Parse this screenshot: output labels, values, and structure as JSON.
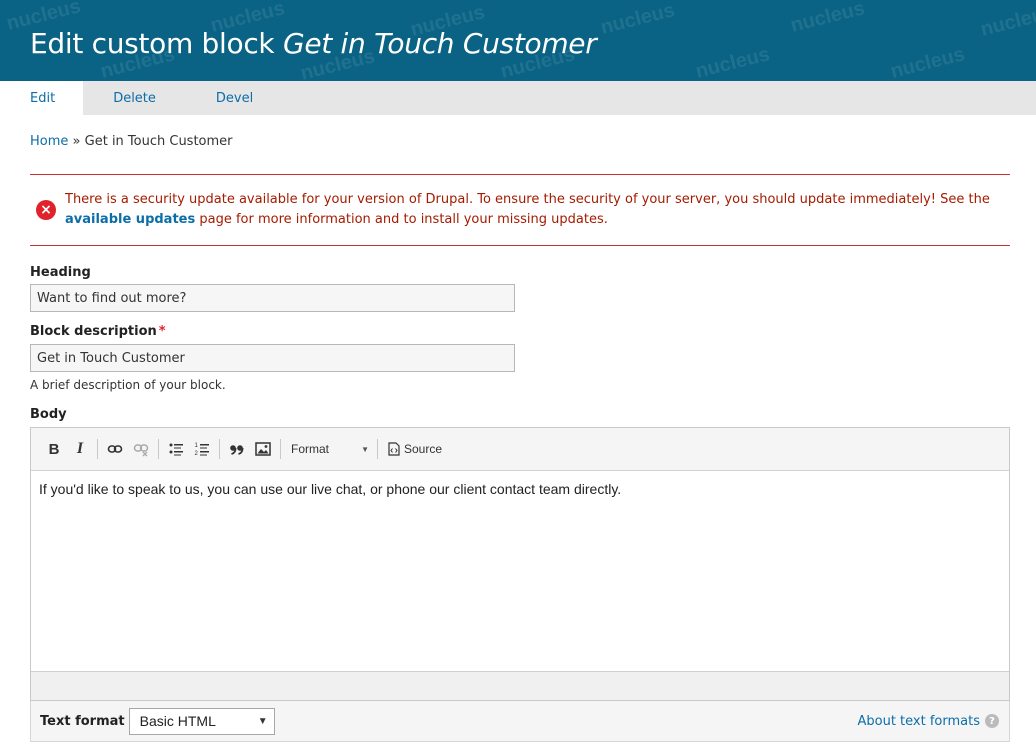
{
  "header": {
    "title_prefix": "Edit custom block ",
    "title_name": "Get in Touch Customer",
    "watermark_text": "nucleus"
  },
  "tabs": [
    {
      "label": "Edit",
      "active": true
    },
    {
      "label": "Delete",
      "active": false
    },
    {
      "label": "Devel",
      "active": false
    }
  ],
  "breadcrumb": {
    "home": "Home",
    "separator": "»",
    "current": "Get in Touch Customer"
  },
  "message": {
    "text_before": "There is a security update available for your version of Drupal. To ensure the security of your server, you should update immediately! See the ",
    "link": "available updates",
    "text_after": " page for more information and to install your missing updates.",
    "icon": "error-icon",
    "color": "#a51b00"
  },
  "form": {
    "heading_label": "Heading",
    "heading_value": "Want to find out more?",
    "block_description_label": "Block description",
    "required_marker": "*",
    "block_description_value": "Get in Touch Customer",
    "block_description_help": "A brief description of your block.",
    "body_label": "Body"
  },
  "editor": {
    "toolbar": {
      "bold": "B",
      "italic": "I",
      "format": "Format",
      "source": "Source"
    },
    "content": "If you'd like to speak to us, you can use our live chat, or phone our client contact team directly."
  },
  "text_format": {
    "label": "Text format",
    "selected": "Basic HTML",
    "about_link": "About text formats",
    "help_icon": "?"
  },
  "colors": {
    "header_bg": "#0a6384",
    "link": "#0b6ea8",
    "error": "#e0232b"
  }
}
